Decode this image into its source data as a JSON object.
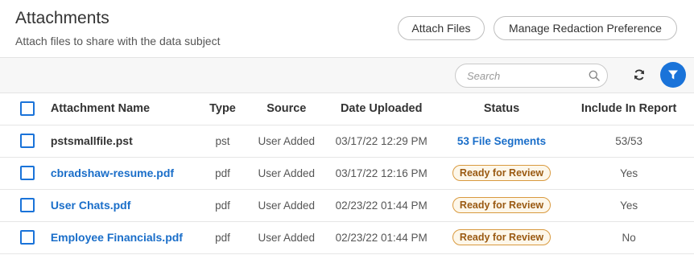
{
  "header": {
    "title": "Attachments",
    "subtitle": "Attach files to share with the data subject",
    "attach_button": "Attach Files",
    "manage_button": "Manage Redaction Preference"
  },
  "toolbar": {
    "search_placeholder": "Search",
    "icons": [
      "search-icon",
      "refresh-icon",
      "filter-icon"
    ],
    "accent_color": "#1a73d9"
  },
  "table": {
    "columns": [
      "Attachment Name",
      "Type",
      "Source",
      "Date Uploaded",
      "Status",
      "Include In Report"
    ],
    "rows": [
      {
        "name": "pstsmallfile.pst",
        "type": "pst",
        "source": "User Added",
        "date": "03/17/22 12:29 PM",
        "status": "53 File Segments",
        "include": "53/53"
      },
      {
        "name": "cbradshaw-resume.pdf",
        "type": "pdf",
        "source": "User Added",
        "date": "03/17/22 12:16 PM",
        "status": "Ready for Review",
        "include": "Yes"
      },
      {
        "name": "User Chats.pdf",
        "type": "pdf",
        "source": "User Added",
        "date": "02/23/22 01:44 PM",
        "status": "Ready for Review",
        "include": "Yes"
      },
      {
        "name": "Employee Financials.pdf",
        "type": "pdf",
        "source": "User Added",
        "date": "02/23/22 01:44 PM",
        "status": "Ready for Review",
        "include": "No"
      }
    ]
  }
}
